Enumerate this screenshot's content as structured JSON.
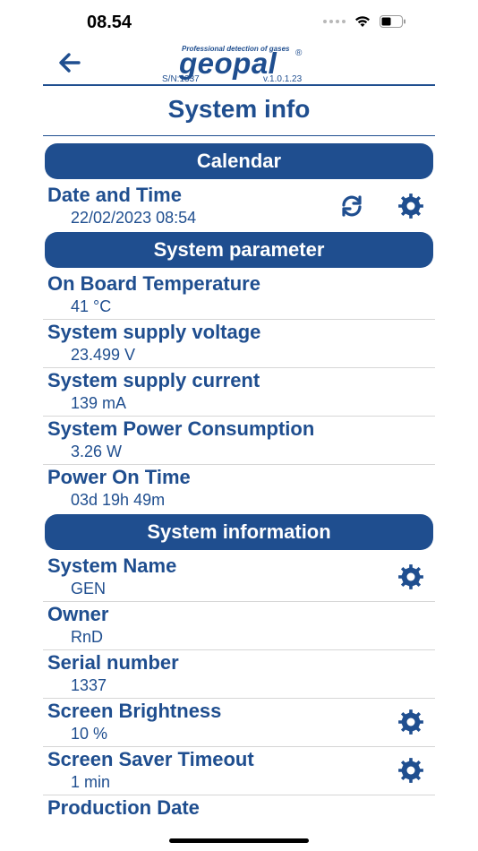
{
  "status_bar": {
    "time": "08.54"
  },
  "header": {
    "logo": {
      "tagline": "Professional detection of gases",
      "wordmark": "geopal",
      "registered_mark": "®",
      "serial": "S/N:1337",
      "version": "v.1.0.1.23"
    }
  },
  "page": {
    "title": "System info"
  },
  "sections": {
    "calendar": {
      "title": "Calendar",
      "date_time": {
        "label": "Date and Time",
        "value": "22/02/2023 08:54"
      }
    },
    "system_parameter": {
      "title": "System parameter",
      "items": [
        {
          "label": "On Board Temperature",
          "value": "41 °C"
        },
        {
          "label": "System supply voltage",
          "value": "23.499 V"
        },
        {
          "label": "System supply current",
          "value": "139 mA"
        },
        {
          "label": "System Power Consumption",
          "value": "3.26 W"
        },
        {
          "label": "Power On Time",
          "value": "03d 19h 49m"
        }
      ]
    },
    "system_information": {
      "title": "System information",
      "items": [
        {
          "label": "System Name",
          "value": "GEN"
        },
        {
          "label": "Owner",
          "value": "RnD"
        },
        {
          "label": "Serial number",
          "value": "1337"
        },
        {
          "label": "Screen Brightness",
          "value": "10 %"
        },
        {
          "label": "Screen Saver Timeout",
          "value": "1 min"
        },
        {
          "label": "Production Date",
          "value": ""
        }
      ]
    }
  },
  "colors": {
    "brand_blue": "#1f4e8f",
    "divider": "#d6d6d6",
    "background": "#ffffff"
  },
  "icons": {
    "back": "arrow-left-icon",
    "refresh": "refresh-icon",
    "settings": "gear-icon"
  }
}
